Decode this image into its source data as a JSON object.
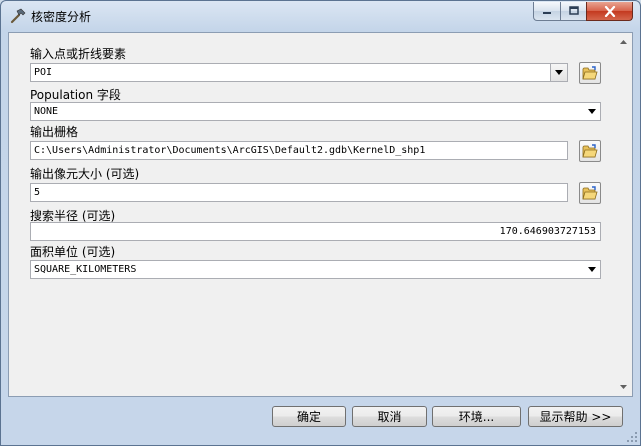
{
  "window": {
    "title": "核密度分析"
  },
  "params": [
    {
      "label": "输入点或折线要素",
      "value": "POI"
    },
    {
      "label": "Population 字段",
      "value": "NONE"
    },
    {
      "label": "输出栅格",
      "value": "C:\\Users\\Administrator\\Documents\\ArcGIS\\Default2.gdb\\KernelD_shp1"
    },
    {
      "label": "输出像元大小 (可选)",
      "value": "5"
    },
    {
      "label": "搜索半径 (可选)",
      "value": "170.646903727153"
    },
    {
      "label": "面积单位 (可选)",
      "value": "SQUARE_KILOMETERS"
    }
  ],
  "buttons": {
    "ok": "确定",
    "cancel": "取消",
    "env": "环境...",
    "help": "显示帮助 >>"
  },
  "icons": {
    "title": "hammer-icon",
    "folder": "open-folder-icon"
  }
}
